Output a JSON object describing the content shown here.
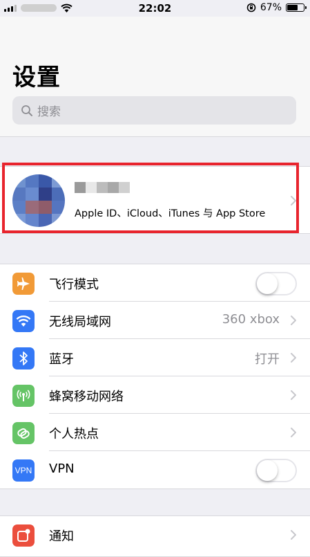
{
  "status_bar": {
    "time": "22:02",
    "battery": "67%",
    "battery_level": 0.67
  },
  "header": {
    "title": "设置",
    "search_placeholder": "搜索"
  },
  "profile": {
    "subtitle": "Apple ID、iCloud、iTunes 与 App Store"
  },
  "settings": [
    {
      "label": "飞行模式",
      "icon": "airplane-icon",
      "color": "#f19a37",
      "toggle": false
    },
    {
      "label": "无线局域网",
      "icon": "wifi-icon",
      "color": "#3478f6",
      "value": "360 xbox"
    },
    {
      "label": "蓝牙",
      "icon": "bluetooth-icon",
      "color": "#3478f6",
      "value": "打开"
    },
    {
      "label": "蜂窝移动网络",
      "icon": "antenna-icon",
      "color": "#65c466"
    },
    {
      "label": "个人热点",
      "icon": "hotspot-link-icon",
      "color": "#65c466"
    },
    {
      "label": "VPN",
      "icon": "vpn-icon",
      "icon_text": "VPN",
      "color": "#3478f6",
      "toggle": false
    },
    {
      "label": "通知",
      "icon": "notifications-icon",
      "color": "#eb4e3d"
    }
  ],
  "colors": {
    "highlight": "#e8242d",
    "background": "#efeff4"
  }
}
